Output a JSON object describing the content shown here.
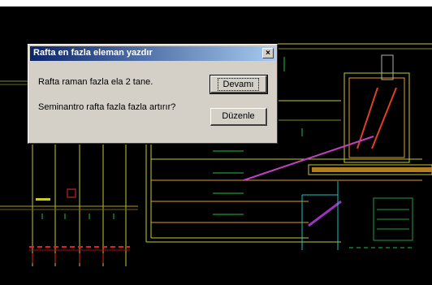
{
  "dialog": {
    "title": "Rafta en fazla eleman yazdır",
    "message_line1": "Rafta raman fazla ela 2 tane.",
    "message_line2": "Seminantro rafta fazla fazla artırır?",
    "primary_button": "Devamı",
    "secondary_button": "Düzenle",
    "close_glyph": "×"
  },
  "colors": {
    "cad_background": "#000000",
    "dialog_face": "#d4d0c8",
    "titlebar_start": "#0a246a",
    "titlebar_end": "#a6caf0"
  },
  "icons": [
    "close-icon"
  ]
}
